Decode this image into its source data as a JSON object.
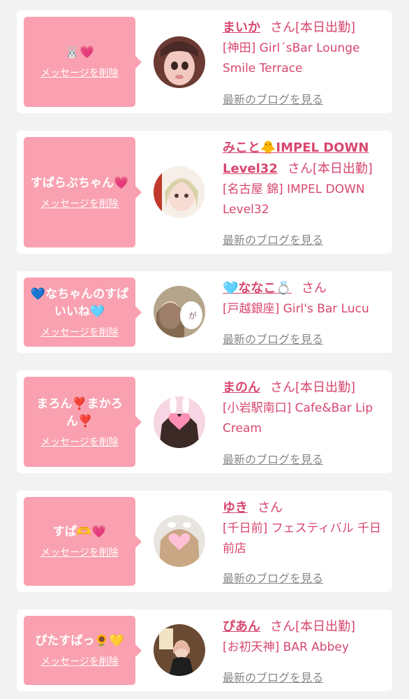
{
  "colors": {
    "accent": "#d8476e",
    "bubble": "#f9a1b0",
    "link_gray": "#888888",
    "page_bg": "#f2f2f2"
  },
  "delete_label": "メッセージを削除",
  "blog_label": "最新のブログを見る",
  "entries": [
    {
      "message": "🐰💗",
      "name": "まいか",
      "honorific": "さん",
      "status": "[本日出勤]",
      "shop": "[神田] Girl´sBar Lounge Smile Terrace"
    },
    {
      "message": "すぱらぶちゃん💗",
      "name": "みこと🐥IMPEL DOWN Level32",
      "honorific": "さん",
      "status": "[本日出勤]",
      "shop": "[名古屋 錦] IMPEL DOWN Level32"
    },
    {
      "message": "💙なちゃんのすぱ\nいいね🩵",
      "name": "🩵ななこ💍",
      "honorific": "さん",
      "status": "",
      "shop": "[戸越銀座] Girl's Bar Lucu"
    },
    {
      "message": "まろん❣️まかろ\nん❣️",
      "name": "まのん",
      "honorific": "さん",
      "status": "[本日出勤]",
      "shop": "[小岩駅南口] Cafe&Bar Lip Cream"
    },
    {
      "message": "すぱ🫶💗",
      "name": "ゆき",
      "honorific": "さん",
      "status": "",
      "shop": "[千日前] フェスティバル 千日前店"
    },
    {
      "message": "ぴたすぱっ🌻💛",
      "name": "ぴあん",
      "honorific": "さん",
      "status": "[本日出勤]",
      "shop": "[お初天神] BAR Abbey"
    }
  ]
}
